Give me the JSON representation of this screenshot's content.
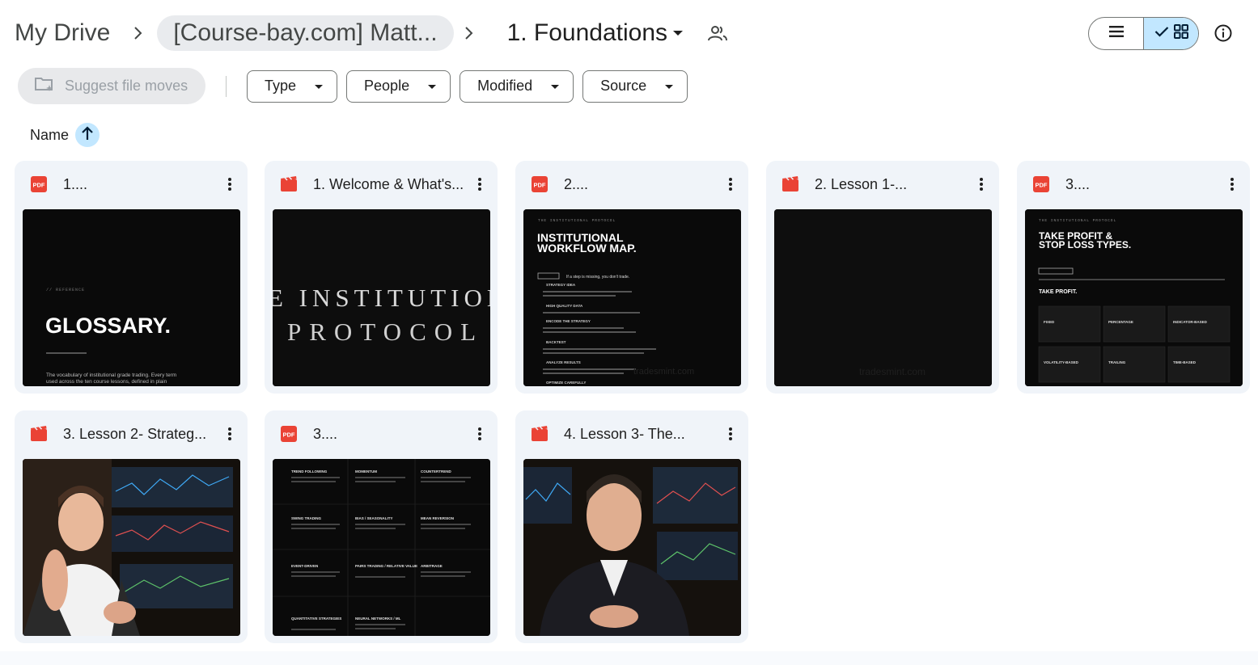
{
  "breadcrumb": {
    "root": "My Drive",
    "parent": "[Course-bay.com] Matt...",
    "current": "1. Foundations"
  },
  "icons": {
    "separator": "chevron-right-icon",
    "dropdown": "caret-down-icon",
    "shared": "people-icon",
    "list_view": "list-icon",
    "grid_view": "grid-icon",
    "check": "check-icon",
    "info": "info-icon",
    "suggest": "folder-sparkle-icon",
    "sort": "arrow-up-icon",
    "pdf": "pdf-icon",
    "video": "video-icon",
    "more": "more-vert-icon"
  },
  "filters": {
    "suggest_label": "Suggest file moves",
    "chips": [
      "Type",
      "People",
      "Modified",
      "Source"
    ]
  },
  "sort": {
    "label": "Name"
  },
  "files": [
    {
      "name": "1....",
      "type": "pdf",
      "thumb": {
        "tag": "// REFERENCE",
        "title": "GLOSSARY.",
        "body_1": "The vocabulary of institutional grade trading. Every term",
        "body_2": "used across the ten course lessons, defined in plain"
      }
    },
    {
      "name": "1. Welcome & What's...",
      "type": "video",
      "thumb": {
        "line_1": "E INSTITUTION",
        "line_2": "PROTOCOL"
      }
    },
    {
      "name": "2....",
      "type": "pdf",
      "thumb": {
        "header": "THE INSTITUTIONAL PROTOCOL",
        "title_1": "INSTITUTIONAL",
        "title_2": "WORKFLOW MAP.",
        "rule": "If a step is missing, you don't trade.",
        "steps": [
          "STRATEGY IDEA",
          "HIGH QUALITY DATA",
          "ENCODE THE STRATEGY",
          "BACKTEST",
          "ANALYZE RESULTS",
          "OPTIMIZE CAREFULLY"
        ],
        "watermark": "tradesmint.com"
      }
    },
    {
      "name": "2. Lesson 1-...",
      "type": "video",
      "thumb": {
        "watermark": "tradesmint.com"
      }
    },
    {
      "name": "3....",
      "type": "pdf",
      "thumb": {
        "header": "THE INSTITUTIONAL PROTOCOL",
        "title_1": "TAKE PROFIT &",
        "title_2": "STOP LOSS TYPES.",
        "section": "TAKE PROFIT.",
        "cells": [
          "FIXED",
          "PERCENTAGE",
          "INDICATOR-BASED",
          "VOLATILITY-BASED",
          "TRAILING",
          "TIME-BASED"
        ]
      }
    },
    {
      "name": "3. Lesson 2- Strateg...",
      "type": "video",
      "thumb": {
        "kind": "presenter"
      }
    },
    {
      "name": "3....",
      "type": "pdf",
      "thumb": {
        "cells": [
          "TREND FOLLOWING",
          "MOMENTUM",
          "COUNTERTREND",
          "SWING TRADING",
          "BIAS / SEASONALITY",
          "MEAN REVERSION",
          "EVENT-DRIVEN",
          "PAIRS TRADING / RELATIVE VALUE",
          "ARBITRAGE",
          "QUANTITATIVE STRATEGIES",
          "NEURAL NETWORKS / ML"
        ]
      }
    },
    {
      "name": "4. Lesson 3- The...",
      "type": "video",
      "thumb": {
        "kind": "presenter"
      }
    }
  ],
  "colors": {
    "pdf_red": "#ea4335",
    "selected_blue": "#c2e7ff",
    "card_bg": "#f0f4f9"
  }
}
